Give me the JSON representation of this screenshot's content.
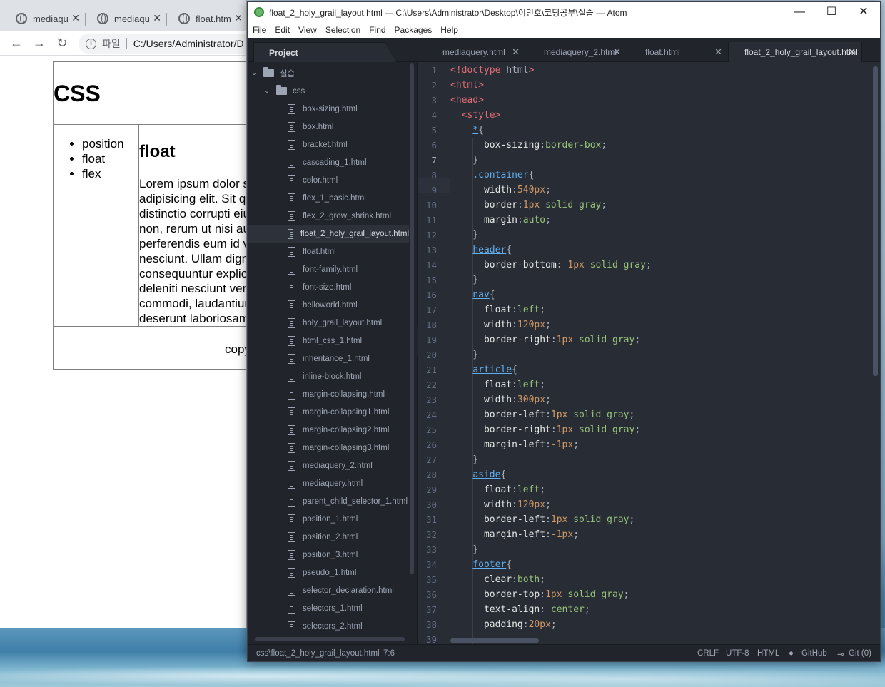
{
  "browser": {
    "tabs": [
      {
        "title": "mediaqu"
      },
      {
        "title": "mediaqu"
      },
      {
        "title": "float.htm"
      }
    ],
    "url_scheme_label": "파일",
    "url": "C:/Users/Administrator/D",
    "page": {
      "header_title": "CSS",
      "nav_items": [
        "position",
        "float",
        "flex"
      ],
      "article_title": "float",
      "article_lines": [
        "Lorem ipsum dolor s",
        "adipisicing elit. Sit qu",
        "distinctio corrupti eiu",
        "non, rerum ut nisi au",
        "perferendis eum id v",
        "nesciunt. Ullam digni",
        "consequuntur explica",
        "deleniti nesciunt veri",
        "commodi, laudantium",
        "deserunt laboriosam."
      ],
      "footer_text": "copy"
    }
  },
  "atom": {
    "window_title": "float_2_holy_grail_layout.html — C:\\Users\\Administrator\\Desktop\\이민호\\코딩공부\\실습 — Atom",
    "menu": [
      "File",
      "Edit",
      "View",
      "Selection",
      "Find",
      "Packages",
      "Help"
    ],
    "project_tab": "Project",
    "tree": {
      "root_folder": "실습",
      "sub_folder": "css",
      "files": [
        "box-sizing.html",
        "box.html",
        "bracket.html",
        "cascading_1.html",
        "color.html",
        "flex_1_basic.html",
        "flex_2_grow_shrink.html",
        "float_2_holy_grail_layout.html",
        "float.html",
        "font-family.html",
        "font-size.html",
        "helloworld.html",
        "holy_grail_layout.html",
        "html_css_1.html",
        "inheritance_1.html",
        "inline-block.html",
        "margin-collapsing.html",
        "margin-collapsing1.html",
        "margin-collapsing2.html",
        "margin-collapsing3.html",
        "mediaquery_2.html",
        "mediaquery.html",
        "parent_child_selector_1.html",
        "position_1.html",
        "position_2.html",
        "position_3.html",
        "pseudo_1.html",
        "selector_declaration.html",
        "selectors_1.html",
        "selectors_2.html"
      ],
      "selected": "float_2_holy_grail_layout.html"
    },
    "editor_tabs": [
      "mediaquery.html",
      "mediaquery_2.html",
      "float.html",
      "float_2_holy_grail_layout.html"
    ],
    "active_tab": "float_2_holy_grail_layout.html",
    "line_numbers": [
      "1",
      "2",
      "3",
      "4",
      "5",
      "6",
      "7",
      "8",
      "9",
      "10",
      "11",
      "12",
      "13",
      "14",
      "15",
      "16",
      "17",
      "18",
      "19",
      "20",
      "21",
      "22",
      "23",
      "24",
      "25",
      "26",
      "27",
      "28",
      "29",
      "30",
      "31",
      "32",
      "33",
      "34",
      "35",
      "36",
      "37",
      "38",
      "39"
    ],
    "code_lines": [
      "<!doctype html>",
      "<html>",
      "<head>",
      "  <style>",
      "    *{",
      "      box-sizing:border-box;",
      "    }",
      "    .container{",
      "      width:540px;",
      "      border:1px solid gray;",
      "      margin:auto;",
      "    }",
      "    header{",
      "      border-bottom: 1px solid gray;",
      "    }",
      "    nav{",
      "      float:left;",
      "      width:120px;",
      "      border-right:1px solid gray;",
      "    }",
      "    article{",
      "      float:left;",
      "      width:300px;",
      "      border-left:1px solid gray;",
      "      border-right:1px solid gray;",
      "      margin-left:-1px;",
      "    }",
      "    aside{",
      "      float:left;",
      "      width:120px;",
      "      border-left:1px solid gray;",
      "      margin-left:-1px;",
      "    }",
      "    footer{",
      "      clear:both;",
      "      border-top:1px solid gray;",
      "      text-align: center;",
      "      padding:20px;",
      ""
    ],
    "status": {
      "path": "css\\float_2_holy_grail_layout.html",
      "cursor": "7:6",
      "line_ending": "CRLF",
      "encoding": "UTF-8",
      "grammar": "HTML",
      "github": "GitHub",
      "git": "Git (0)"
    }
  }
}
